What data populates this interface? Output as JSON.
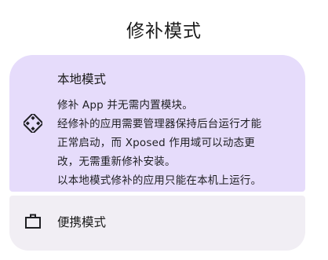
{
  "dialog": {
    "title": "修补模式"
  },
  "modes": {
    "local": {
      "icon": "diamond-dots-icon",
      "title": "本地模式",
      "description_lines": [
        "修补 App 并无需内置模块。",
        "经修补的应用需要管理器保持后台运行才能",
        "正常启动，而 Xposed 作用域可以动态更",
        "改，无需重新修补安装。",
        "以本地模式修补的应用只能在本机上运行。"
      ],
      "selected": true
    },
    "portable": {
      "icon": "briefcase-icon",
      "title": "便携模式",
      "selected": false
    }
  },
  "colors": {
    "selected_bg": "#e6dcfb",
    "unselected_bg": "#f1eef4",
    "text": "#1a1a1a"
  }
}
